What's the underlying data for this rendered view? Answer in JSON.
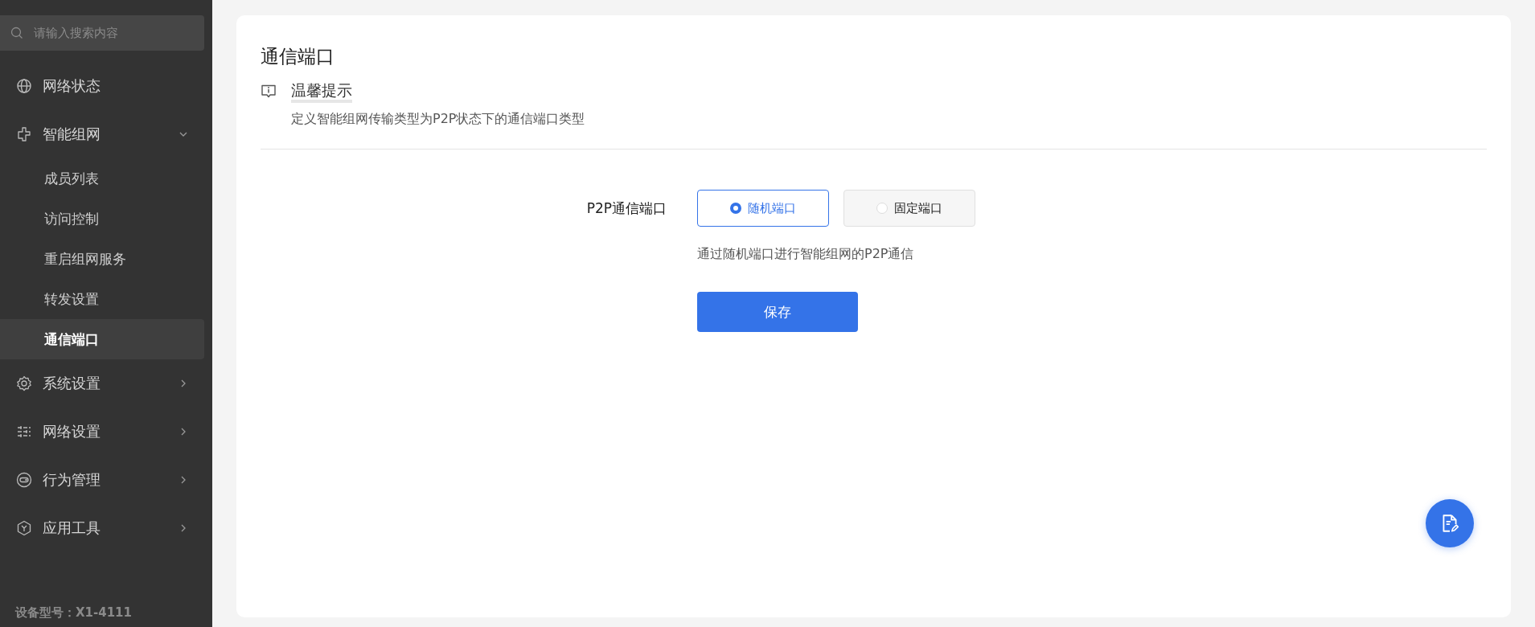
{
  "sidebar": {
    "search": {
      "placeholder": "请输入搜索内容"
    },
    "items": [
      {
        "label": "网络状态",
        "selected": false
      },
      {
        "label": "智能组网",
        "expanded": true,
        "selected": false,
        "children": [
          {
            "label": "成员列表",
            "selected": false
          },
          {
            "label": "访问控制",
            "selected": false
          },
          {
            "label": "重启组网服务",
            "selected": false
          },
          {
            "label": "转发设置",
            "selected": false
          },
          {
            "label": "通信端口",
            "selected": true
          }
        ]
      },
      {
        "label": "系统设置",
        "expanded": false,
        "selected": false
      },
      {
        "label": "网络设置",
        "expanded": false,
        "selected": false
      },
      {
        "label": "行为管理",
        "expanded": false,
        "selected": false
      },
      {
        "label": "应用工具",
        "expanded": false,
        "selected": false
      }
    ],
    "footer": "设备型号：X1-4111"
  },
  "content": {
    "title": "通信端口",
    "tip": {
      "title": "温馨提示",
      "text": "定义智能组网传输类型为P2P状态下的通信端口类型"
    },
    "form": {
      "label": "P2P通信端口",
      "options": [
        {
          "label": "随机端口",
          "selected": true
        },
        {
          "label": "固定端口",
          "selected": false
        }
      ],
      "help": "通过随机端口进行智能组网的P2P通信",
      "save": "保存"
    }
  }
}
